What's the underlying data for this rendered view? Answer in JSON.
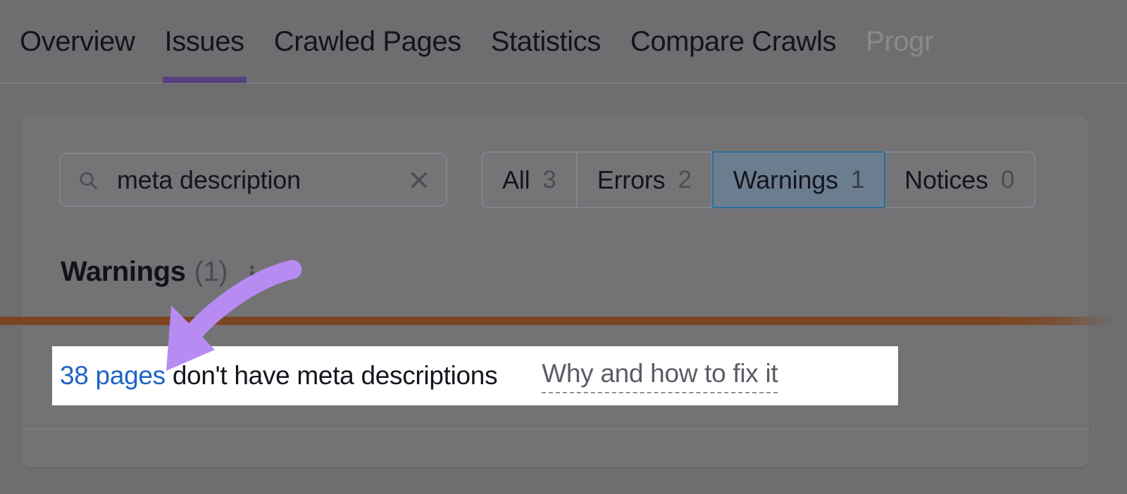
{
  "tabs": [
    {
      "label": "Overview",
      "active": false,
      "faded": false
    },
    {
      "label": "Issues",
      "active": true,
      "faded": false
    },
    {
      "label": "Crawled Pages",
      "active": false,
      "faded": false
    },
    {
      "label": "Statistics",
      "active": false,
      "faded": false
    },
    {
      "label": "Compare Crawls",
      "active": false,
      "faded": false
    },
    {
      "label": "Progr",
      "active": false,
      "faded": true
    }
  ],
  "search": {
    "value": "meta description",
    "placeholder": "Search",
    "icon": "search-icon",
    "clear_icon": "close-icon"
  },
  "filters": [
    {
      "label": "All",
      "count": "3",
      "selected": false
    },
    {
      "label": "Errors",
      "count": "2",
      "selected": false
    },
    {
      "label": "Warnings",
      "count": "1",
      "selected": true
    },
    {
      "label": "Notices",
      "count": "0",
      "selected": false
    }
  ],
  "section": {
    "title": "Warnings",
    "count": "(1)",
    "info_icon": "info-icon"
  },
  "issue": {
    "link_text": "38 pages",
    "rest_text": " don't have meta descriptions",
    "fix_label": "Why and how to fix it"
  },
  "colors": {
    "accent_purple": "#56417f",
    "annotation_purple": "#b88bf2",
    "link_blue": "#1f64c4",
    "selected_blue_border": "#2c6f9e",
    "selected_blue_fill": "#6b7e90",
    "rule_brown": "#7c4521",
    "page_bg": "#6e6e70",
    "card_bg": "#737375",
    "row_white": "#ffffff"
  }
}
